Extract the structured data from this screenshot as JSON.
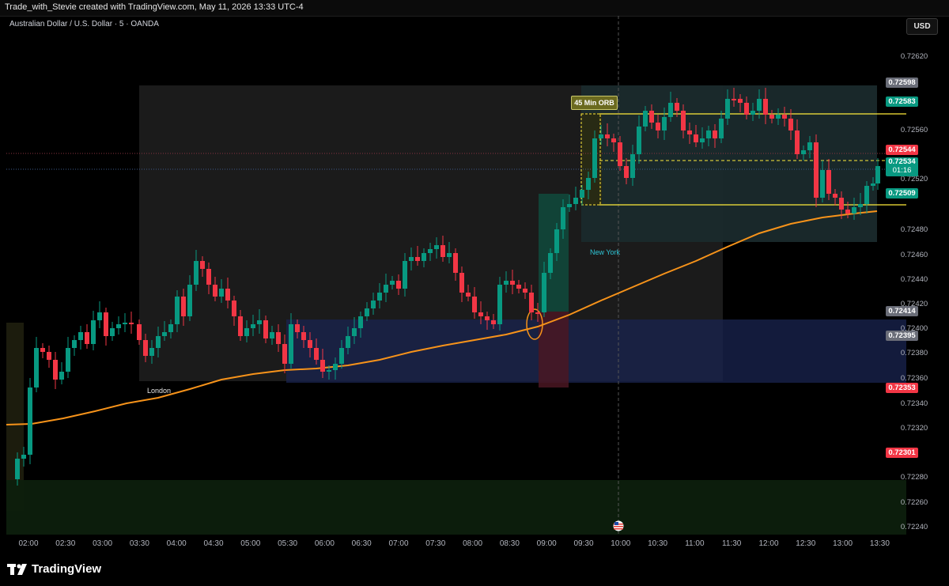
{
  "header": {
    "text": "Trade_with_Stevie created with TradingView.com, May 11, 2026 13:33 UTC-4"
  },
  "symbol": {
    "title": "Australian Dollar / U.S. Dollar · 5 · OANDA"
  },
  "currency_button": "USD",
  "price_axis": {
    "labels": [
      "0.72540",
      "0.72520",
      "0.72500",
      "0.72480",
      "0.72460",
      "0.72440",
      "0.72420",
      "0.72400",
      "0.72380",
      "0.72360",
      "0.72340",
      "0.72320",
      "0.72280",
      "0.72260",
      "0.72240"
    ],
    "label_top": "0.72620",
    "label_560": "0.72560"
  },
  "price_tags": {
    "t1": "0.72598",
    "t2": "0.72583",
    "t3": "0.72544",
    "t4": "0.72534",
    "t4_timer": "01:16",
    "t5": "0.72509",
    "t6": "0.72414",
    "t7": "0.72395",
    "t8": "0.72353",
    "t9": "0.72301"
  },
  "time_axis": [
    "02:00",
    "02:30",
    "03:00",
    "03:30",
    "04:00",
    "04:30",
    "05:00",
    "05:30",
    "06:00",
    "06:30",
    "07:00",
    "07:30",
    "08:00",
    "08:30",
    "09:00",
    "09:30",
    "10:00",
    "10:30",
    "11:00",
    "11:30",
    "12:00",
    "12:30",
    "13:00",
    "13:30"
  ],
  "annotations": {
    "orb": "45 Min ORB",
    "london": "London",
    "new_york": "New York"
  },
  "colors": {
    "up": "#089981",
    "down": "#f23645",
    "ema": "#f7931a",
    "orb_line": "#ffeb3b",
    "tag_green": "#089981",
    "tag_red": "#f23645",
    "tag_gray": "#6a6d78"
  },
  "branding": {
    "logo_text": "TradingView"
  },
  "chart_data": {
    "type": "candlestick",
    "title": "Australian Dollar / U.S. Dollar · 5 · OANDA",
    "timeframe": "5",
    "x_range": [
      "02:00",
      "13:30"
    ],
    "ylim": [
      0.7223,
      0.7263
    ],
    "ema_last": 0.72495,
    "orb_high": 0.72583,
    "orb_low": 0.72501,
    "orb_mid": 0.7254,
    "last_price": 0.72534,
    "grid": false
  }
}
